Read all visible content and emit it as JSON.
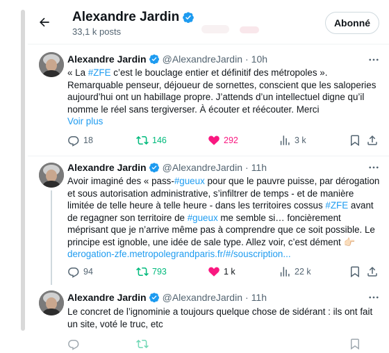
{
  "header": {
    "name": "Alexandre Jardin",
    "post_count": "33,1 k posts",
    "follow_label": "Abonné"
  },
  "tweets": [
    {
      "name": "Alexandre Jardin",
      "handle": "@AlexandreJardin",
      "sep": "·",
      "time": "10h",
      "text_parts": [
        "« La ",
        "#ZFE",
        " c’est le bouclage entier et définitif des métropoles ». Remarquable penseur, déjoueur de sornettes, conscient que les saloperies aujourd’hui ont un habillage propre. J’attends d’un intellectuel digne qu’il nomme le réel sans tergiverser. À écouter et réécouter. Merci"
      ],
      "show_more": "Voir plus",
      "replies": "18",
      "retweets": "146",
      "likes": "292",
      "views": "3 k"
    },
    {
      "name": "Alexandre Jardin",
      "handle": "@AlexandreJardin",
      "sep": "·",
      "time": "11h",
      "text_parts": [
        "Avoir imaginé des « pass-",
        "#gueux",
        " pour que le pauvre puisse, par dérogation et sous autorisation administrative, s’infiltrer de temps - et de manière limitée de telle heure à telle heure - dans les territoires cossus ",
        "#ZFE",
        " avant de regagner son territoire de ",
        "#gueux",
        " me semble si… foncièrement méprisant que je n’arrive même pas à comprendre que ce soit possible. Le principe est ignoble, une idée de sale type. Allez voir, c’est dément 👉🏻 ",
        "derogation-zfe.metropolegrandparis.fr/#/souscription..."
      ],
      "replies": "94",
      "retweets": "793",
      "likes": "1 k",
      "views": "22 k"
    },
    {
      "name": "Alexandre Jardin",
      "handle": "@AlexandreJardin",
      "sep": "·",
      "time": "11h",
      "text": "Le concret de l’ignominie a toujours quelque chose de sidérant : ils ont fait un site, voté le truc, etc"
    }
  ],
  "colors": {
    "accent": "#1d9bf0",
    "retweet": "#00ba7c",
    "like": "#f91880",
    "muted": "#536471"
  }
}
